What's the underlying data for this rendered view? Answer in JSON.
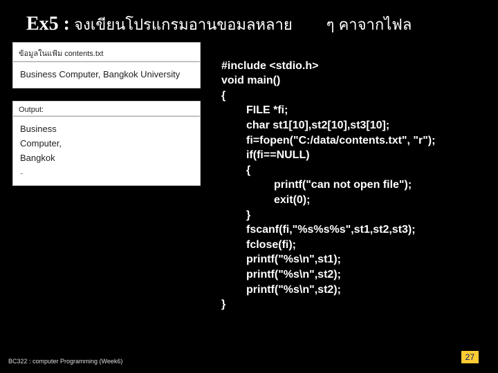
{
  "title": {
    "ex_label": "Ex5 :",
    "thai_left": "จงเขียนโปรแกรมอานขอมลหลาย",
    "thai_right": "ๆ คาจากไฟล"
  },
  "file_box": {
    "label": "ข้อมูลในแฟ้ม contents.txt",
    "content": "Business Computer, Bangkok University"
  },
  "output_box": {
    "label": "Output:",
    "line1": "Business",
    "line2": "Computer,",
    "line3": "Bangkok",
    "dash": "-"
  },
  "code": {
    "l1": "#include <stdio.h>",
    "l2": "void main()",
    "l3": "{",
    "l4": "FILE *fi;",
    "l5": "char st1[10],st2[10],st3[10];",
    "l6": "fi=fopen(\"C:/data/contents.txt\", \"r\");",
    "l7": "if(fi==NULL)",
    "l8": "{",
    "l9": "printf(\"can not open file\");",
    "l10": "exit(0);",
    "l11": "}",
    "l12": "fscanf(fi,\"%s%s%s\",st1,st2,st3);",
    "l13": "fclose(fi);",
    "l14": "printf(\"%s\\n\",st1);",
    "l15": "printf(\"%s\\n\",st2);",
    "l16": "printf(\"%s\\n\",st2);",
    "l17": "}"
  },
  "footer": "BC322 : computer Programming (Week6)",
  "pagenum": "27"
}
